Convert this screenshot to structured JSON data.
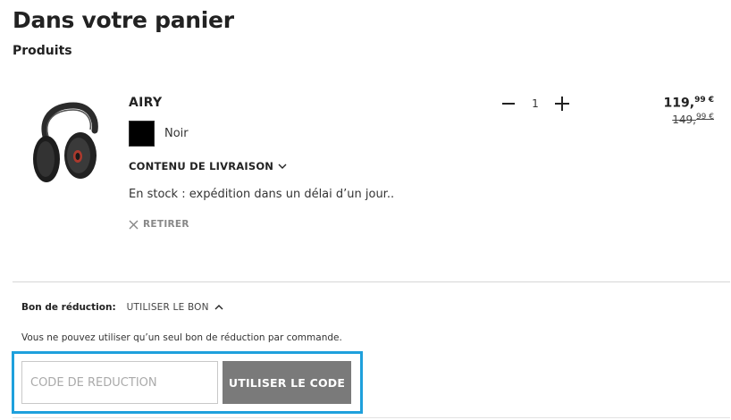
{
  "header": {
    "title": "Dans votre panier",
    "section": "Produits"
  },
  "item": {
    "name": "AIRY",
    "color": "Noir",
    "swatch_color": "#000000",
    "delivery_toggle": "CONTENU DE LIVRAISON",
    "stock": "En stock : expédition dans un délai d’un jour..",
    "remove": "RETIRER",
    "quantity": "1",
    "price": {
      "current_main": "119,",
      "current_cents": "99 €",
      "old_main": "149,",
      "old_cents": "99 €"
    }
  },
  "voucher": {
    "label": "Bon de réduction:",
    "toggle": "UTILISER LE BON",
    "note": "Vous ne pouvez utiliser qu’un seul bon de réduction par commande.",
    "input_placeholder": "CODE DE RÉDUCTION",
    "input_value": "",
    "button": "UTILISER LE CODE",
    "highlight_color": "#1ea0dc"
  }
}
